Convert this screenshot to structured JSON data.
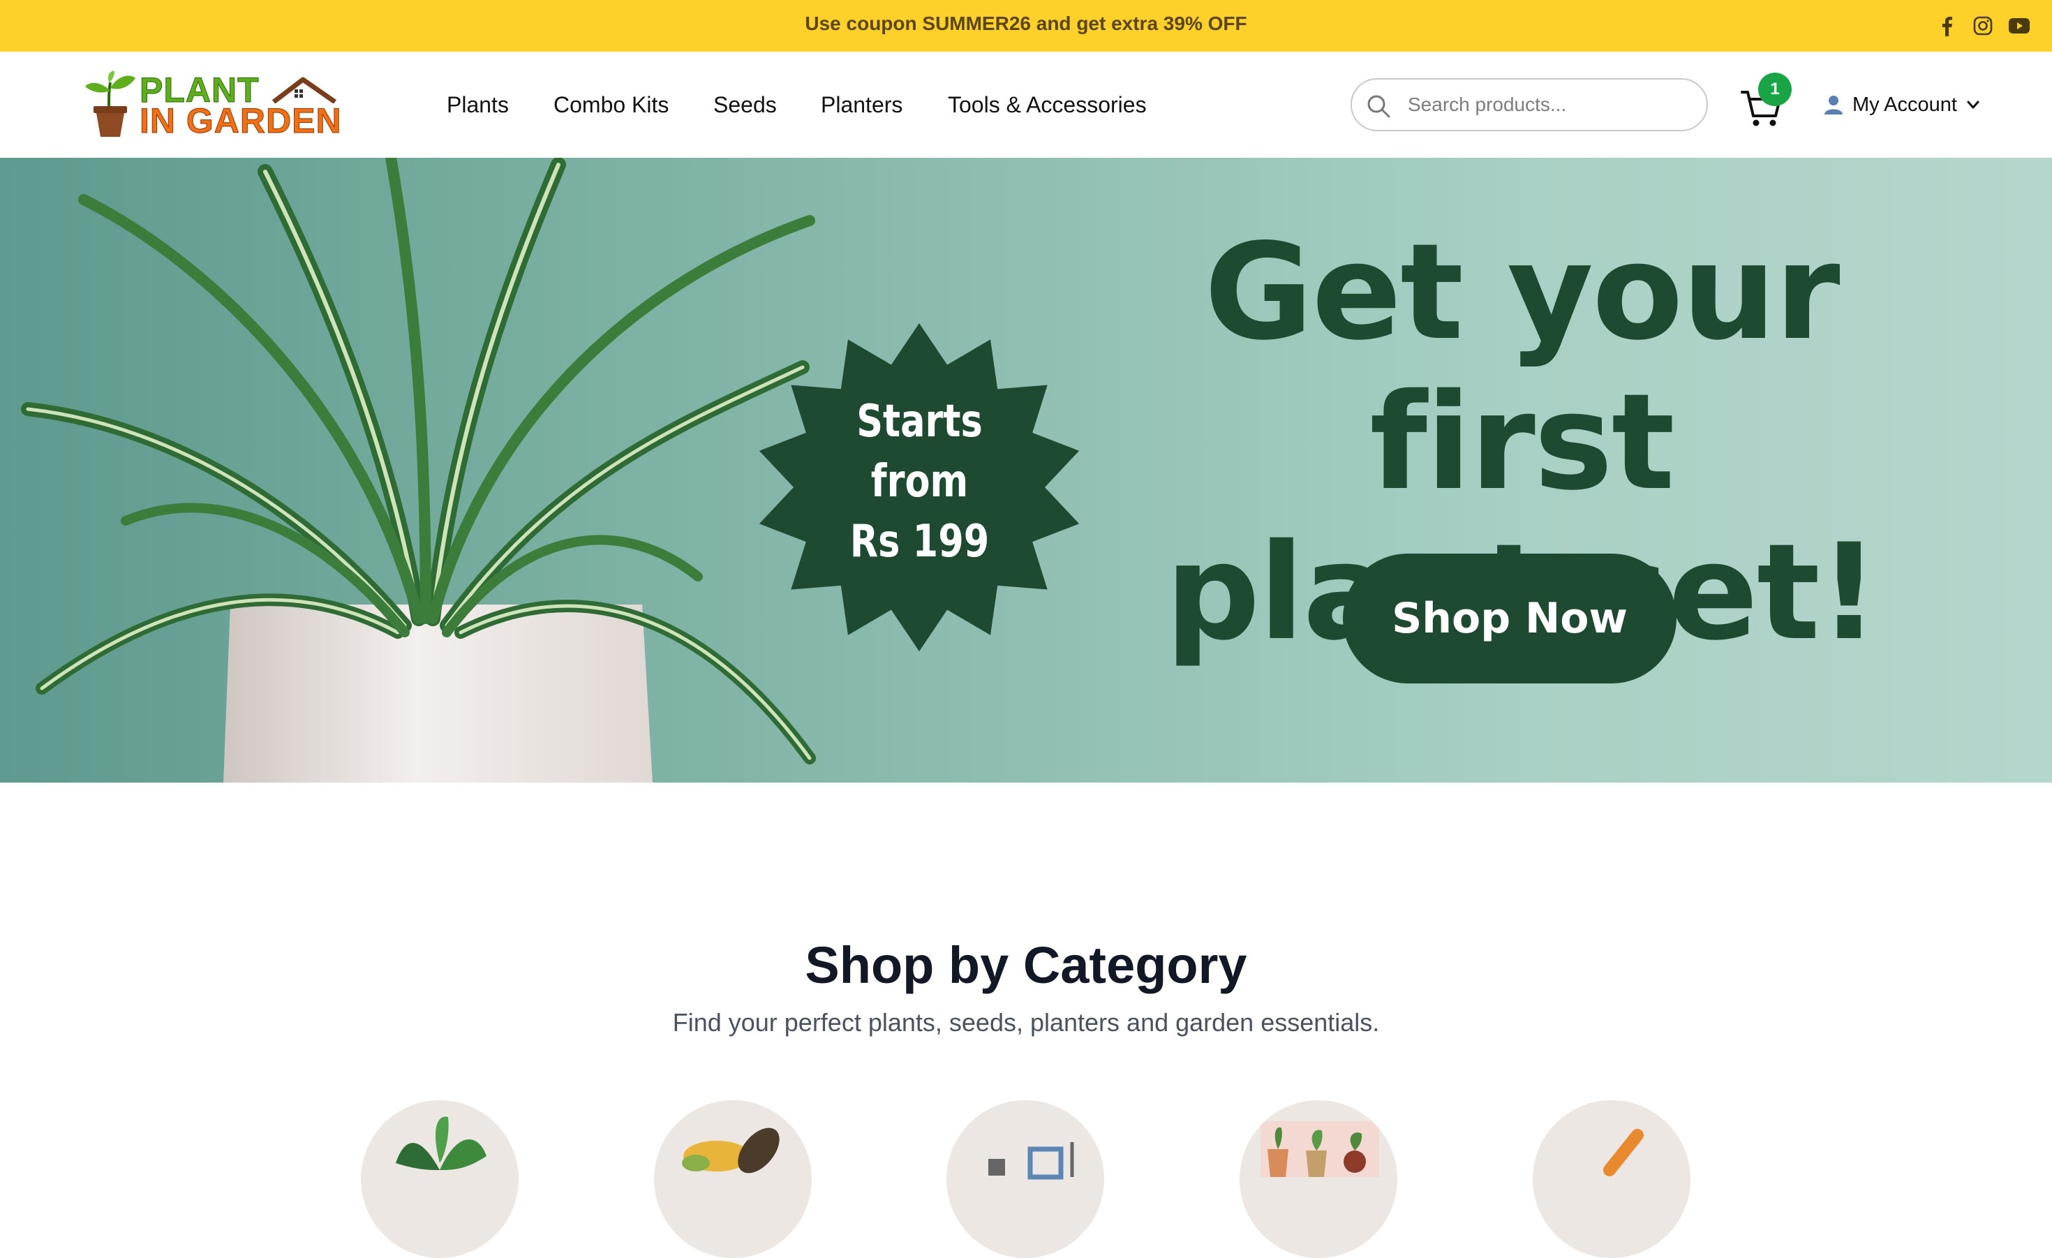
{
  "announcement": {
    "text": "Use coupon SUMMER26 and get extra 39% OFF",
    "social_icons": [
      "facebook-icon",
      "instagram-icon",
      "youtube-icon"
    ]
  },
  "header": {
    "logo": {
      "line1": "PLANT",
      "line2": "IN GARDEN"
    },
    "nav": [
      "Plants",
      "Combo Kits",
      "Seeds",
      "Planters",
      "Tools & Accessories"
    ],
    "search": {
      "placeholder": "Search products...",
      "value": ""
    },
    "cart": {
      "count": "1"
    },
    "account": {
      "label": "My Account"
    }
  },
  "hero": {
    "title_line1": "Get your first",
    "title_line2": "plant set!",
    "badge": {
      "line1": "Starts",
      "line2": "from",
      "line3": "Rs 199"
    },
    "cta": "Shop Now",
    "slides": {
      "count": 4,
      "active_index": 2
    }
  },
  "categories": {
    "title": "Shop by Category",
    "subtitle": "Find your perfect plants, seeds, planters and garden essentials.",
    "items": [
      {
        "icon": "potted-plant-icon"
      },
      {
        "icon": "seeds-icon"
      },
      {
        "icon": "planter-shelf-icon"
      },
      {
        "icon": "plant-combo-icon"
      },
      {
        "icon": "garden-tool-icon"
      }
    ]
  },
  "colors": {
    "topbar": "#fdd12a",
    "brand_green": "#1f4a32",
    "badge_green": "#19a546",
    "logo_green": "#5fae1b",
    "logo_orange": "#f26f13"
  }
}
